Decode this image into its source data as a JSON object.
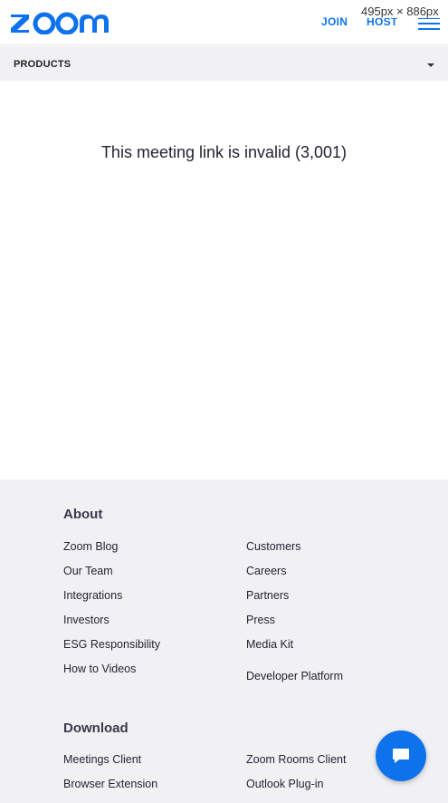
{
  "header": {
    "logo_text": "zoom",
    "join_label": "JOIN",
    "host_label": "HOST",
    "size_badge": "495px × 886px"
  },
  "products_bar": {
    "label": "PRODUCTS"
  },
  "main": {
    "message": "This meeting link is invalid (3,001)"
  },
  "footer": {
    "about": {
      "title": "About",
      "left_links": [
        "Zoom Blog",
        "Our Team",
        "Integrations",
        "Investors",
        "ESG Responsibility",
        "How to Videos"
      ],
      "right_links": [
        "Customers",
        "Careers",
        "Partners",
        "Press",
        "Media Kit",
        "Developer Platform"
      ]
    },
    "download": {
      "title": "Download",
      "left_links": [
        "Meetings Client",
        "Browser Extension"
      ],
      "right_links": [
        "Zoom Rooms Client",
        "Outlook Plug-in"
      ]
    }
  },
  "colors": {
    "brand": "#0e72ed",
    "footer_bg": "#f1f1f4",
    "text": "#232333"
  }
}
